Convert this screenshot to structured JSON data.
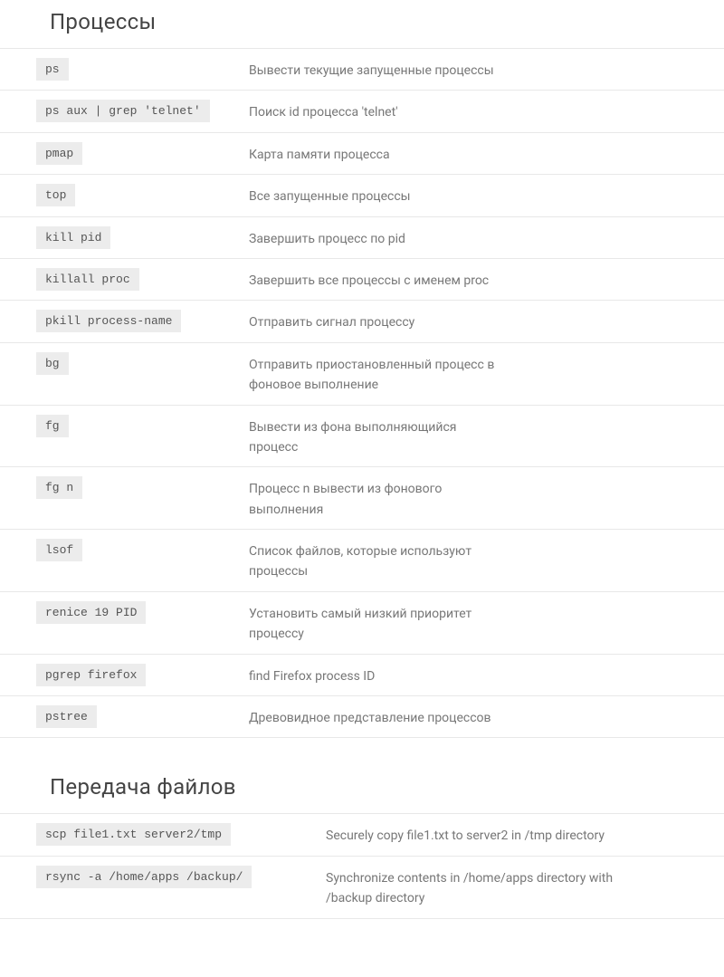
{
  "sections": [
    {
      "title": "Процессы",
      "layout": "normal",
      "rows": [
        {
          "command": "ps",
          "description": "Вывести текущие запущенные процессы"
        },
        {
          "command": "ps aux | grep 'telnet'",
          "description": "Поиск id процесса 'telnet'"
        },
        {
          "command": "pmap",
          "description": "Карта памяти процесса"
        },
        {
          "command": "top",
          "description": " Все запущенные процессы"
        },
        {
          "command": "kill pid",
          "description": "Завершить процесс по pid"
        },
        {
          "command": "killall proc",
          "description": "Завершить все процессы с именем proc"
        },
        {
          "command": "pkill process-name",
          "description": "Отправить сигнал процессу"
        },
        {
          "command": "bg",
          "description": "Отправить приостановленный процесс в фоновое выполнение"
        },
        {
          "command": "fg",
          "description": "Вывести из фона выполняющийся процесс"
        },
        {
          "command": "fg n",
          "description": "Процесс n вывести из фонового выполнения"
        },
        {
          "command": "lsof",
          "description": "Список файлов, которые используют процессы"
        },
        {
          "command": "renice 19 PID",
          "description": "Установить самый низкий приоритет процессу"
        },
        {
          "command": "pgrep firefox",
          "description": "find Firefox process ID"
        },
        {
          "command": "pstree",
          "description": "Древовидное представление процессов"
        }
      ]
    },
    {
      "title": "Передача файлов",
      "layout": "wide",
      "rows": [
        {
          "command": "scp file1.txt server2/tmp",
          "description": "Securely copy file1.txt to server2 in /tmp directory"
        },
        {
          "command": "rsync -a /home/apps  /backup/",
          "description": "Synchronize contents in /home/apps directory with /backup  directory"
        }
      ]
    }
  ]
}
